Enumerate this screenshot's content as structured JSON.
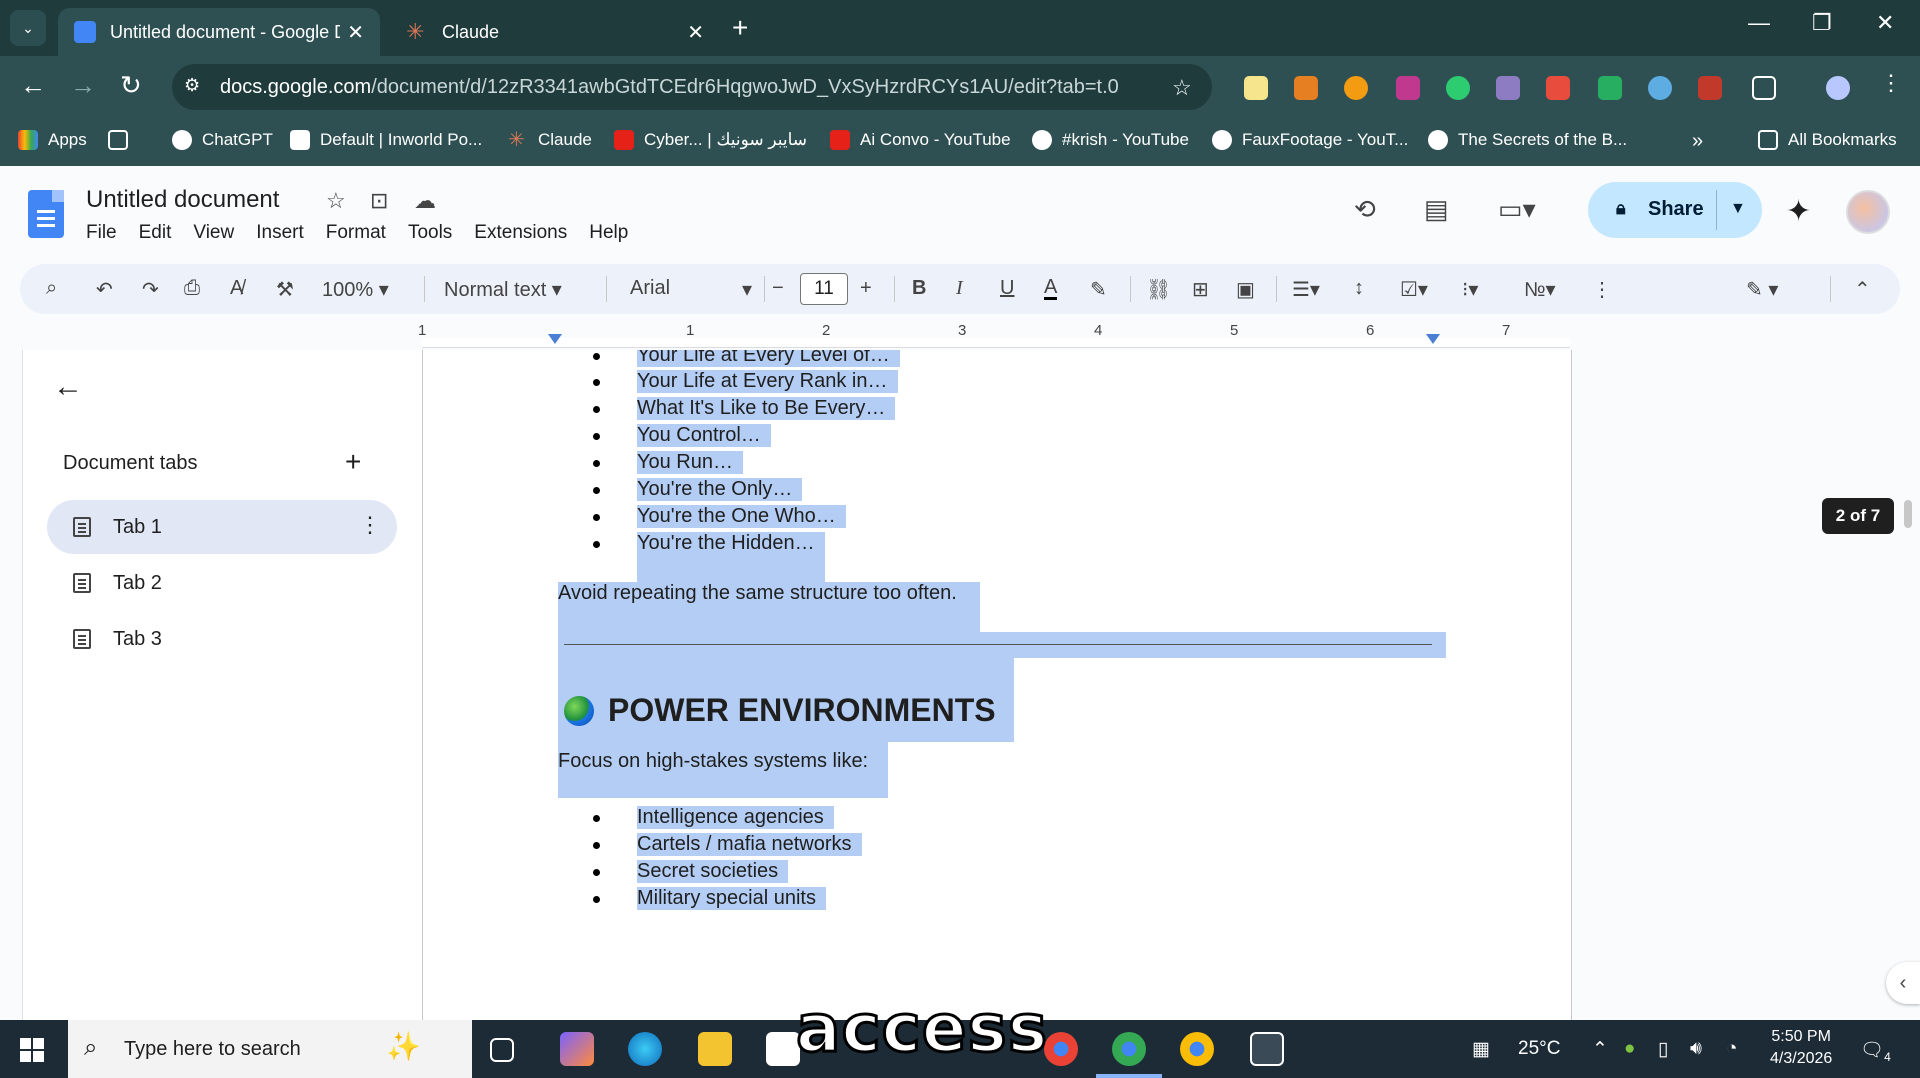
{
  "browser": {
    "tabs": [
      {
        "title": "Untitled document - Google Docs",
        "active": true
      },
      {
        "title": "Claude",
        "active": false
      }
    ],
    "url_domain": "docs.google.com",
    "url_path": "/document/d/12zR3341awbGtdTCEdr6HqgwoJwD_VxSyHzrdRCYs1AU/edit?tab=t.0",
    "bookmarks": [
      "Apps",
      "ChatGPT",
      "Default | Inworld Po...",
      "Claude",
      "Cyber... | سايبر سونيك",
      "Ai Convo - YouTube",
      "#krish - YouTube",
      "FauxFootage - YouT...",
      "The Secrets of the B..."
    ],
    "all_bookmarks": "All Bookmarks"
  },
  "docs": {
    "title": "Untitled document",
    "menu": [
      "File",
      "Edit",
      "View",
      "Insert",
      "Format",
      "Tools",
      "Extensions",
      "Help"
    ],
    "share_label": "Share",
    "toolbar": {
      "zoom": "100%",
      "style": "Normal text",
      "font": "Arial",
      "font_size": "11"
    },
    "ruler_numbers": [
      "1",
      "1",
      "2",
      "3",
      "4",
      "5",
      "6",
      "7"
    ]
  },
  "side_panel": {
    "heading": "Document tabs",
    "tabs": [
      "Tab 1",
      "Tab 2",
      "Tab 3"
    ]
  },
  "document": {
    "bullets_top": [
      "Your Life at Every Level of…",
      "Your Life at Every Rank in…",
      "What It's Like to Be Every…",
      "You Control…",
      "You Run…",
      "You're the Only…",
      "You're the One Who…",
      "You're the Hidden…"
    ],
    "avoid_text": "Avoid repeating the same structure too often.",
    "section_heading": "POWER ENVIRONMENTS",
    "focus_text": "Focus on high-stakes systems like:",
    "bullets_bottom": [
      "Intelligence agencies",
      "Cartels / mafia networks",
      "Secret societies",
      "Military special units"
    ],
    "page_indicator": "2 of 7"
  },
  "taskbar": {
    "search_placeholder": "Type here to search",
    "temperature": "25°C",
    "time": "5:50 PM",
    "date": "4/3/2026",
    "notifications": "4"
  },
  "caption": "access"
}
